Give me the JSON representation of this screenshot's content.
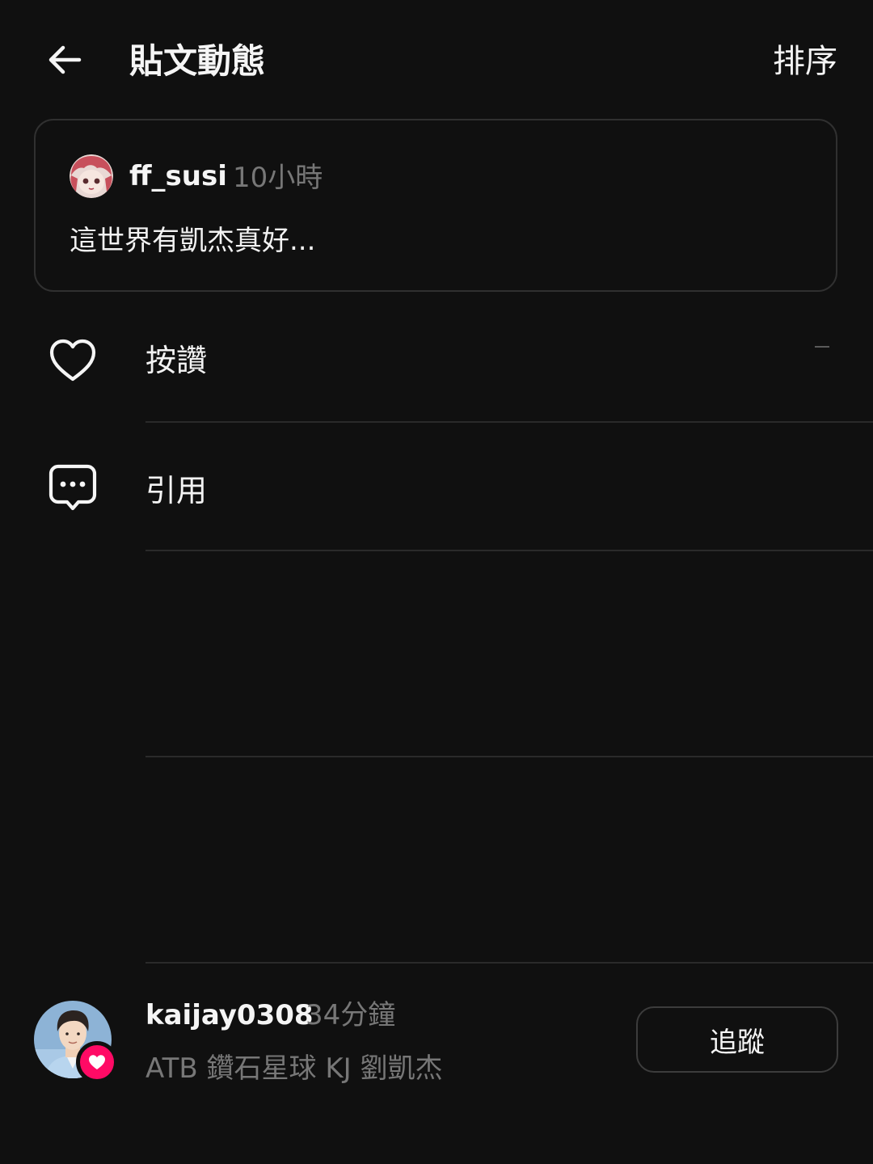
{
  "header": {
    "back_icon": "arrow-left-icon",
    "title": "貼文動態",
    "sort_label": "排序"
  },
  "post": {
    "avatar_icon": "anime-avatar",
    "username": "ff_susi",
    "time": "10小時",
    "text": "這世界有凱杰真好..."
  },
  "activity": [
    {
      "label": "按讚",
      "icon": "heart-outline-icon"
    },
    {
      "label": "引用",
      "icon": "speech-bubble-ellipsis-icon"
    }
  ],
  "user": {
    "username": "kaijay0308",
    "time": "34分鐘",
    "bio": "ATB 鑽石星球 KJ 劉凱杰",
    "badge_icon": "heart-badge-icon",
    "follow_label": "追蹤"
  },
  "colors": {
    "background": "#101010",
    "text_primary": "#f5f5f5",
    "text_secondary": "#777777",
    "border": "#303030",
    "badge": "#ff0a65"
  }
}
